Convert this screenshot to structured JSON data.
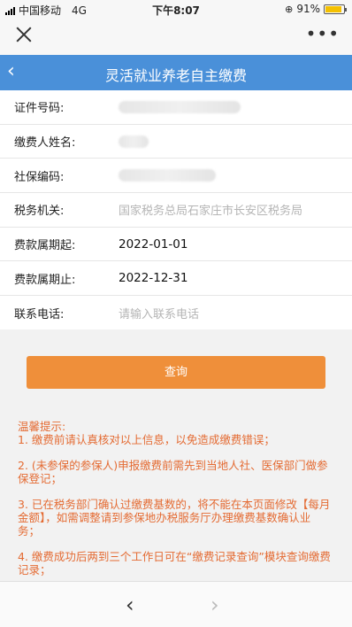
{
  "status_bar": {
    "carrier": "中国移动",
    "network": "4G",
    "time": "下午8:07",
    "battery": "91%",
    "battery_level": 0.91
  },
  "header": {
    "title": "灵活就业养老自主缴费"
  },
  "form": {
    "id_label": "证件号码:",
    "name_label": "缴费人姓名:",
    "social_label": "社保编码:",
    "tax_label": "税务机关:",
    "tax_value": "国家税务总局石家庄市长安区税务局",
    "start_label": "费款属期起:",
    "start_value": "2022-01-01",
    "end_label": "费款属期止:",
    "end_value": "2022-12-31",
    "phone_label": "联系电话:",
    "phone_placeholder": "请输入联系电话"
  },
  "query_button": "查询",
  "tips": {
    "title": "温馨提示:",
    "items": [
      "1. 缴费前请认真核对以上信息，以免造成缴费错误；",
      "2. (未参保的参保人)申报缴费前需先到当地人社、医保部门做参保登记；",
      "3. 已在税务部门确认过缴费基数的，将不能在本页面修改【每月金额】，如需调整请到参保地办税服务厅办理缴费基数确认业务；",
      "4. 缴费成功后两到三个工作日可在“缴费记录查询”模块查询缴费记录；"
    ]
  },
  "icons": {
    "close": "close-icon",
    "more": "more-icon",
    "back": "back-chevron-icon",
    "nav_back": "nav-back-icon",
    "nav_forward": "nav-forward-icon"
  }
}
